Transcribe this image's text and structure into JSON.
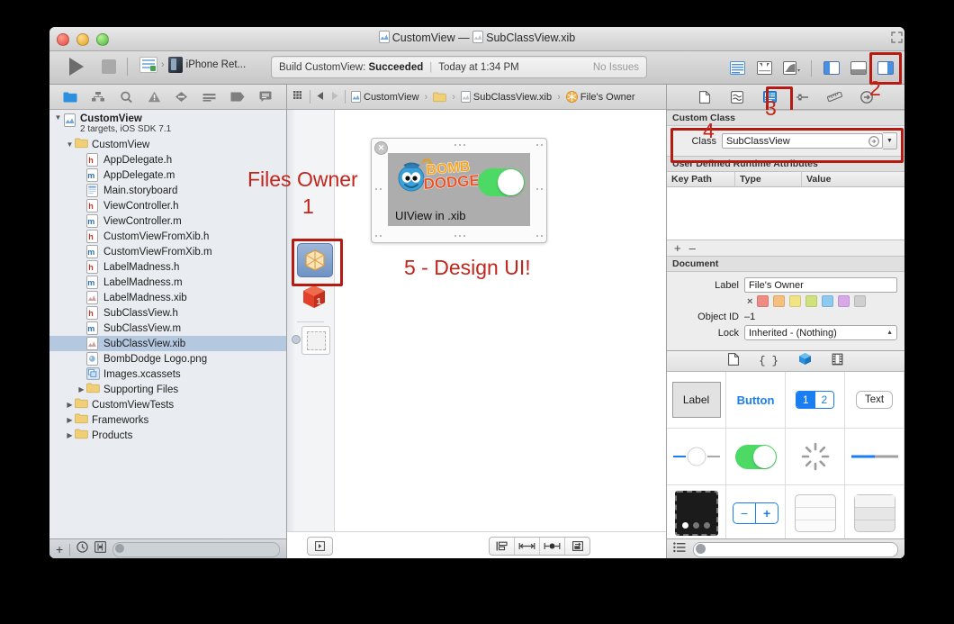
{
  "window": {
    "title": "CustomView — SubClassView.xib",
    "title_project": "CustomView",
    "title_dash": "—",
    "title_file": "SubClassView.xib"
  },
  "toolbar": {
    "run_label": "Run",
    "stop_label": "Stop",
    "scheme_name": "CustomView",
    "destination": "iPhone Ret...",
    "status_prefix": "Build CustomView:",
    "status_result": "Succeeded",
    "status_time": "Today at 1:34 PM",
    "status_issues": "No Issues",
    "editor_buttons": [
      "standard-editor",
      "assistant-editor",
      "version-editor"
    ],
    "view_buttons": [
      "navigator-toggle",
      "debug-toggle",
      "utilities-toggle"
    ]
  },
  "annotations": [
    {
      "id": "files-owner-note",
      "text": "Files Owner"
    },
    {
      "id": "step-1",
      "text": "1"
    },
    {
      "id": "step-2",
      "text": "2"
    },
    {
      "id": "step-3",
      "text": "3"
    },
    {
      "id": "step-4",
      "text": "4"
    },
    {
      "id": "step-5",
      "text": "5 - Design UI!"
    }
  ],
  "navigator": {
    "tabs": [
      "project-navigator",
      "symbol-navigator",
      "search-navigator",
      "issue-navigator",
      "test-navigator",
      "debug-navigator",
      "breakpoint-navigator",
      "log-navigator"
    ],
    "project": {
      "name": "CustomView",
      "subtitle": "2 targets, iOS SDK 7.1"
    },
    "items": [
      {
        "label": "CustomView",
        "icon": "folder",
        "indent": 1,
        "expanded": true,
        "selected": false
      },
      {
        "label": "AppDelegate.h",
        "icon": "header",
        "indent": 2,
        "selected": false
      },
      {
        "label": "AppDelegate.m",
        "icon": "source",
        "indent": 2,
        "selected": false
      },
      {
        "label": "Main.storyboard",
        "icon": "storyboard",
        "indent": 2,
        "selected": false
      },
      {
        "label": "ViewController.h",
        "icon": "header",
        "indent": 2,
        "selected": false
      },
      {
        "label": "ViewController.m",
        "icon": "source",
        "indent": 2,
        "selected": false
      },
      {
        "label": "CustomViewFromXib.h",
        "icon": "header",
        "indent": 2,
        "selected": false
      },
      {
        "label": "CustomViewFromXib.m",
        "icon": "source",
        "indent": 2,
        "selected": false
      },
      {
        "label": "LabelMadness.h",
        "icon": "header",
        "indent": 2,
        "selected": false
      },
      {
        "label": "LabelMadness.m",
        "icon": "source",
        "indent": 2,
        "selected": false
      },
      {
        "label": "LabelMadness.xib",
        "icon": "xib",
        "indent": 2,
        "selected": false
      },
      {
        "label": "SubClassView.h",
        "icon": "header",
        "indent": 2,
        "selected": false
      },
      {
        "label": "SubClassView.m",
        "icon": "source",
        "indent": 2,
        "selected": false
      },
      {
        "label": "SubClassView.xib",
        "icon": "xib",
        "indent": 2,
        "selected": true
      },
      {
        "label": "BombDodge Logo.png",
        "icon": "image",
        "indent": 2,
        "selected": false
      },
      {
        "label": "Images.xcassets",
        "icon": "xcassets",
        "indent": 2,
        "selected": false
      },
      {
        "label": "Supporting Files",
        "icon": "folder",
        "indent": 2,
        "collapsed": true,
        "selected": false
      },
      {
        "label": "CustomViewTests",
        "icon": "folder",
        "indent": 1,
        "collapsed": true,
        "selected": false
      },
      {
        "label": "Frameworks",
        "icon": "folder",
        "indent": 1,
        "collapsed": true,
        "selected": false
      },
      {
        "label": "Products",
        "icon": "folder",
        "indent": 1,
        "collapsed": true,
        "selected": false
      }
    ],
    "bottom": {
      "add_label": "+",
      "buttons": [
        "recent-filter",
        "source-control-filter"
      ],
      "filter_placeholder": ""
    }
  },
  "editor": {
    "jumpbar": {
      "crumbs": [
        "CustomView",
        "",
        "SubClassView.xib",
        "File's Owner"
      ],
      "back_label": "Back",
      "forward_label": "Forward"
    },
    "dock": [
      {
        "name": "files-owner-object",
        "icon": "wireframe-cube",
        "selected": true
      },
      {
        "name": "first-responder-object",
        "icon": "red-cube-1"
      },
      {
        "name": "view-placeholder-object",
        "icon": "dashed-square"
      }
    ],
    "preview": {
      "label_text": "UIView in .xib",
      "logo_top": "BOMB",
      "logo_bottom": "DODGE",
      "switch_state": "on"
    },
    "bottom_buttons": [
      "show-document-outline",
      "align",
      "pin",
      "resolve-issues",
      "resize-behaviour"
    ]
  },
  "inspector": {
    "tabs": [
      "file-inspector",
      "quick-help-inspector",
      "identity-inspector",
      "attributes-inspector",
      "size-inspector",
      "connections-inspector"
    ],
    "selected_tab": "identity-inspector",
    "custom_class": {
      "section_title": "Custom Class",
      "class_label": "Class",
      "class_value": "SubClassView"
    },
    "runtime_attributes": {
      "section_title": "User Defined Runtime Attributes",
      "columns": [
        "Key Path",
        "Type",
        "Value"
      ],
      "rows": [],
      "add_label": "+",
      "remove_label": "–"
    },
    "document": {
      "section_title": "Document",
      "label_label": "Label",
      "label_value": "File's Owner",
      "object_id_label": "Object ID",
      "object_id_value": "–1",
      "lock_label": "Lock",
      "lock_value": "Inherited - (Nothing)",
      "swatch_colors": [
        "#f08a85",
        "#f5bf7e",
        "#f2e384",
        "#cfe27d",
        "#8ec9ef",
        "#d9a8e8",
        "#cfcfcf"
      ],
      "clear_color_label": "×"
    }
  },
  "library": {
    "tabs": [
      "file-template-library",
      "code-snippet-library",
      "object-library",
      "media-library"
    ],
    "selected_tab": "object-library",
    "objects": [
      {
        "name": "label-object",
        "text": "Label"
      },
      {
        "name": "button-object",
        "text": "Button"
      },
      {
        "name": "segmented-control-object",
        "text": "1 2"
      },
      {
        "name": "text-field-object",
        "text": "Text"
      },
      {
        "name": "slider-object",
        "text": ""
      },
      {
        "name": "switch-object",
        "text": ""
      },
      {
        "name": "activity-indicator-object",
        "text": ""
      },
      {
        "name": "progress-view-object",
        "text": ""
      },
      {
        "name": "page-control-object",
        "text": ""
      },
      {
        "name": "stepper-object",
        "text": ""
      },
      {
        "name": "table-view-object",
        "text": ""
      },
      {
        "name": "table-view-cell-object",
        "text": ""
      },
      {
        "name": "tab-bar-object",
        "text": ""
      },
      {
        "name": "toolbar-object",
        "text": ""
      },
      {
        "name": "bar-button-object",
        "text": ""
      },
      {
        "name": "search-bar-object",
        "text": ""
      }
    ],
    "bottom": {
      "view_mode_label": "list-view",
      "filter_placeholder": ""
    }
  },
  "colors": {
    "annotation_red": "#c1251b",
    "box_red": "#b31b13",
    "selection_blue": "#b4c9e0",
    "switch_green": "#4cd964",
    "accent_blue": "#1a7ef0"
  }
}
